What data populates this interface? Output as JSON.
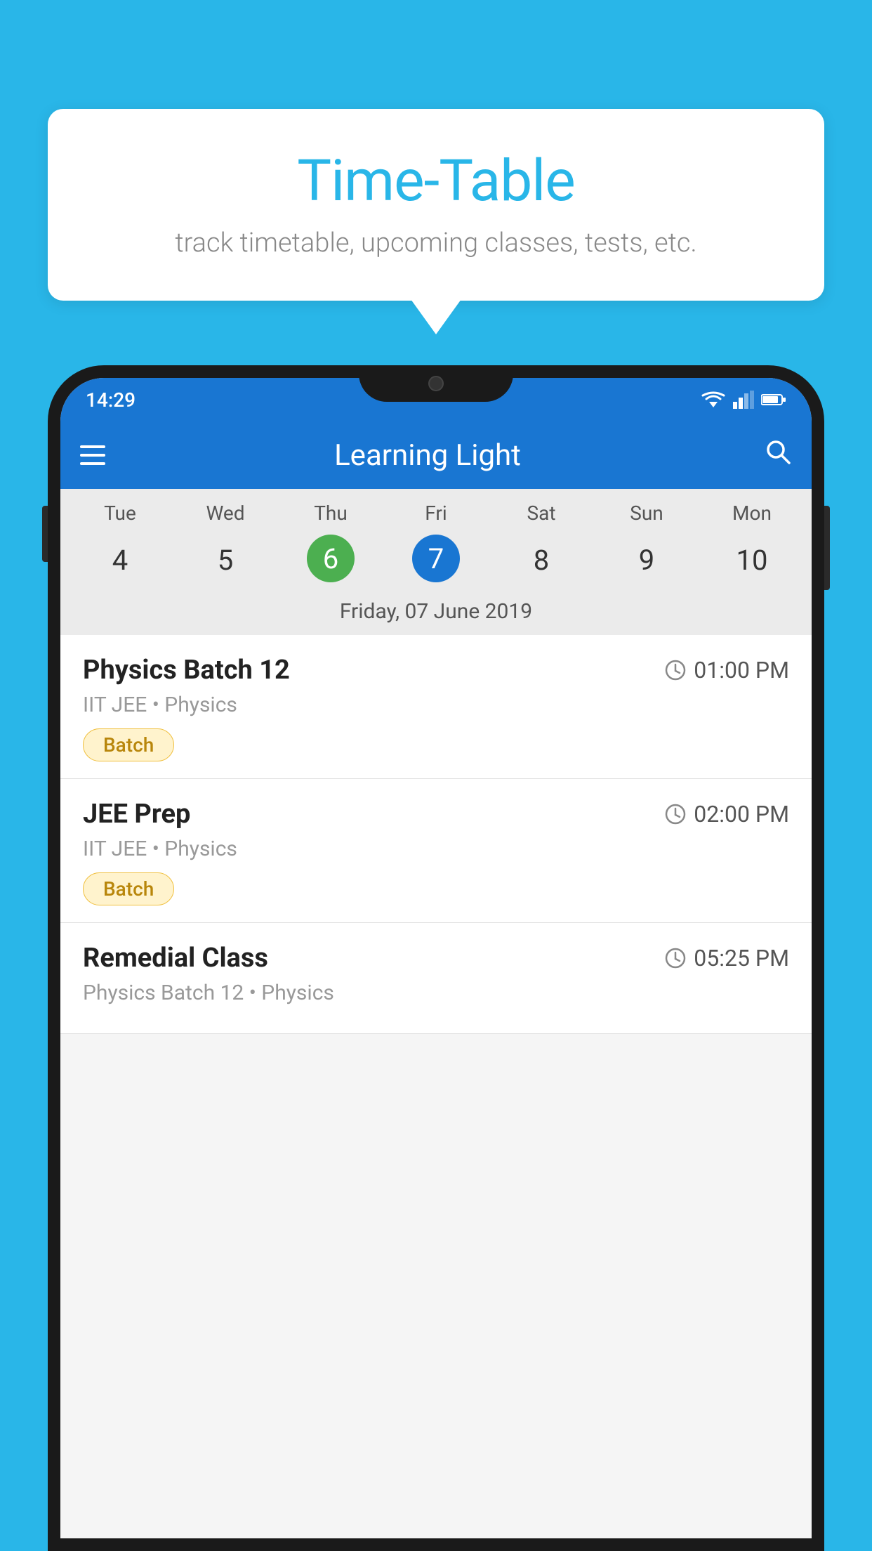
{
  "background_color": "#29B6E8",
  "speech_bubble": {
    "title": "Time-Table",
    "subtitle": "track timetable, upcoming classes, tests, etc."
  },
  "phone": {
    "status_bar": {
      "time": "14:29"
    },
    "app_header": {
      "title": "Learning Light"
    },
    "calendar": {
      "day_headers": [
        "Tue",
        "Wed",
        "Thu",
        "Fri",
        "Sat",
        "Sun",
        "Mon"
      ],
      "day_numbers": [
        "4",
        "5",
        "6",
        "7",
        "8",
        "9",
        "10"
      ],
      "today_index": 2,
      "selected_index": 3,
      "selected_date_label": "Friday, 07 June 2019"
    },
    "schedule_items": [
      {
        "title": "Physics Batch 12",
        "time": "01:00 PM",
        "subtitle": "IIT JEE • Physics",
        "badge": "Batch"
      },
      {
        "title": "JEE Prep",
        "time": "02:00 PM",
        "subtitle": "IIT JEE • Physics",
        "badge": "Batch"
      },
      {
        "title": "Remedial Class",
        "time": "05:25 PM",
        "subtitle": "Physics Batch 12 • Physics",
        "badge": ""
      }
    ]
  }
}
